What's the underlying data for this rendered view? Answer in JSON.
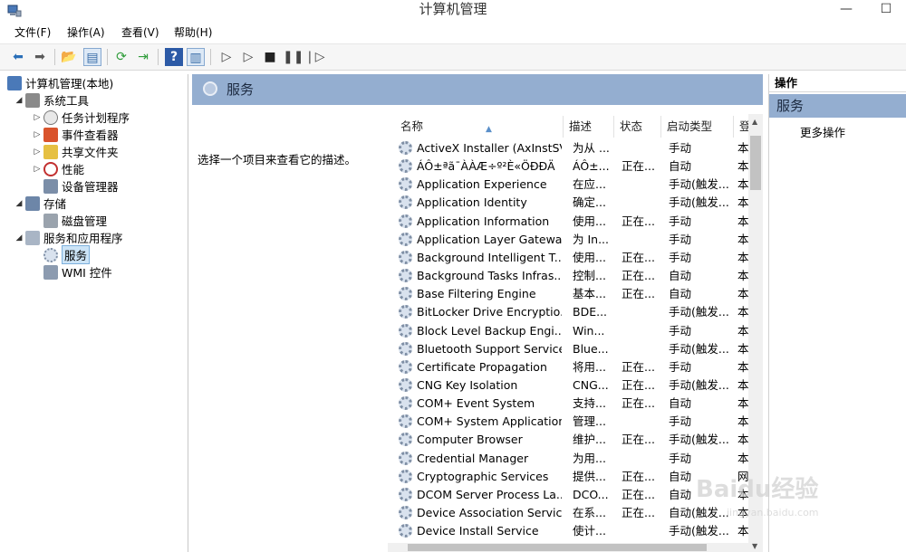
{
  "window": {
    "title": "计算机管理",
    "minimize": "—",
    "maximize": "☐"
  },
  "menu": {
    "file": "文件(F)",
    "action": "操作(A)",
    "view": "查看(V)",
    "help": "帮助(H)"
  },
  "tree": {
    "root": "计算机管理(本地)",
    "system_tools": "系统工具",
    "task_scheduler": "任务计划程序",
    "event_viewer": "事件查看器",
    "shared_folders": "共享文件夹",
    "performance": "性能",
    "device_manager": "设备管理器",
    "storage": "存储",
    "disk_management": "磁盘管理",
    "services_apps": "服务和应用程序",
    "services": "服务",
    "wmi": "WMI 控件"
  },
  "center": {
    "header_title": "服务",
    "description": "选择一个项目来查看它的描述。",
    "columns": {
      "name": "名称",
      "desc": "描述",
      "status": "状态",
      "startup": "启动类型",
      "logon": "登"
    }
  },
  "services": [
    {
      "name": "ActiveX Installer (AxInstSV)",
      "desc": "为从 ...",
      "status": "",
      "startup": "手动",
      "logon": "本"
    },
    {
      "name": "ÁÔ±ªã¯ÀÀÆ÷º²È«ÖÐÐÄ",
      "desc": "ÁÔ±...",
      "status": "正在...",
      "startup": "自动",
      "logon": "本"
    },
    {
      "name": "Application Experience",
      "desc": "在应...",
      "status": "",
      "startup": "手动(触发...",
      "logon": "本"
    },
    {
      "name": "Application Identity",
      "desc": "确定...",
      "status": "",
      "startup": "手动(触发...",
      "logon": "本"
    },
    {
      "name": "Application Information",
      "desc": "使用...",
      "status": "正在...",
      "startup": "手动",
      "logon": "本"
    },
    {
      "name": "Application Layer Gatewa...",
      "desc": "为 In...",
      "status": "",
      "startup": "手动",
      "logon": "本"
    },
    {
      "name": "Background Intelligent T...",
      "desc": "使用...",
      "status": "正在...",
      "startup": "手动",
      "logon": "本"
    },
    {
      "name": "Background Tasks Infras...",
      "desc": "控制...",
      "status": "正在...",
      "startup": "自动",
      "logon": "本"
    },
    {
      "name": "Base Filtering Engine",
      "desc": "基本...",
      "status": "正在...",
      "startup": "自动",
      "logon": "本"
    },
    {
      "name": "BitLocker Drive Encryptio...",
      "desc": "BDE...",
      "status": "",
      "startup": "手动(触发...",
      "logon": "本"
    },
    {
      "name": "Block Level Backup Engi...",
      "desc": "Win...",
      "status": "",
      "startup": "手动",
      "logon": "本"
    },
    {
      "name": "Bluetooth Support Service",
      "desc": "Blue...",
      "status": "",
      "startup": "手动(触发...",
      "logon": "本"
    },
    {
      "name": "Certificate Propagation",
      "desc": "将用...",
      "status": "正在...",
      "startup": "手动",
      "logon": "本"
    },
    {
      "name": "CNG Key Isolation",
      "desc": "CNG...",
      "status": "正在...",
      "startup": "手动(触发...",
      "logon": "本"
    },
    {
      "name": "COM+ Event System",
      "desc": "支持...",
      "status": "正在...",
      "startup": "自动",
      "logon": "本"
    },
    {
      "name": "COM+ System Application",
      "desc": "管理...",
      "status": "",
      "startup": "手动",
      "logon": "本"
    },
    {
      "name": "Computer Browser",
      "desc": "维护...",
      "status": "正在...",
      "startup": "手动(触发...",
      "logon": "本"
    },
    {
      "name": "Credential Manager",
      "desc": "为用...",
      "status": "",
      "startup": "手动",
      "logon": "本"
    },
    {
      "name": "Cryptographic Services",
      "desc": "提供...",
      "status": "正在...",
      "startup": "自动",
      "logon": "网"
    },
    {
      "name": "DCOM Server Process La...",
      "desc": "DCO...",
      "status": "正在...",
      "startup": "自动",
      "logon": "本"
    },
    {
      "name": "Device Association Service",
      "desc": "在系...",
      "status": "正在...",
      "startup": "自动(触发...",
      "logon": "本"
    },
    {
      "name": "Device Install Service",
      "desc": "使计...",
      "status": "",
      "startup": "手动(触发...",
      "logon": "本"
    }
  ],
  "actions": {
    "header": "操作",
    "section": "服务",
    "more": "更多操作"
  },
  "watermark": {
    "brand": "Baidu经验",
    "url": "jingyan.baidu.com"
  }
}
